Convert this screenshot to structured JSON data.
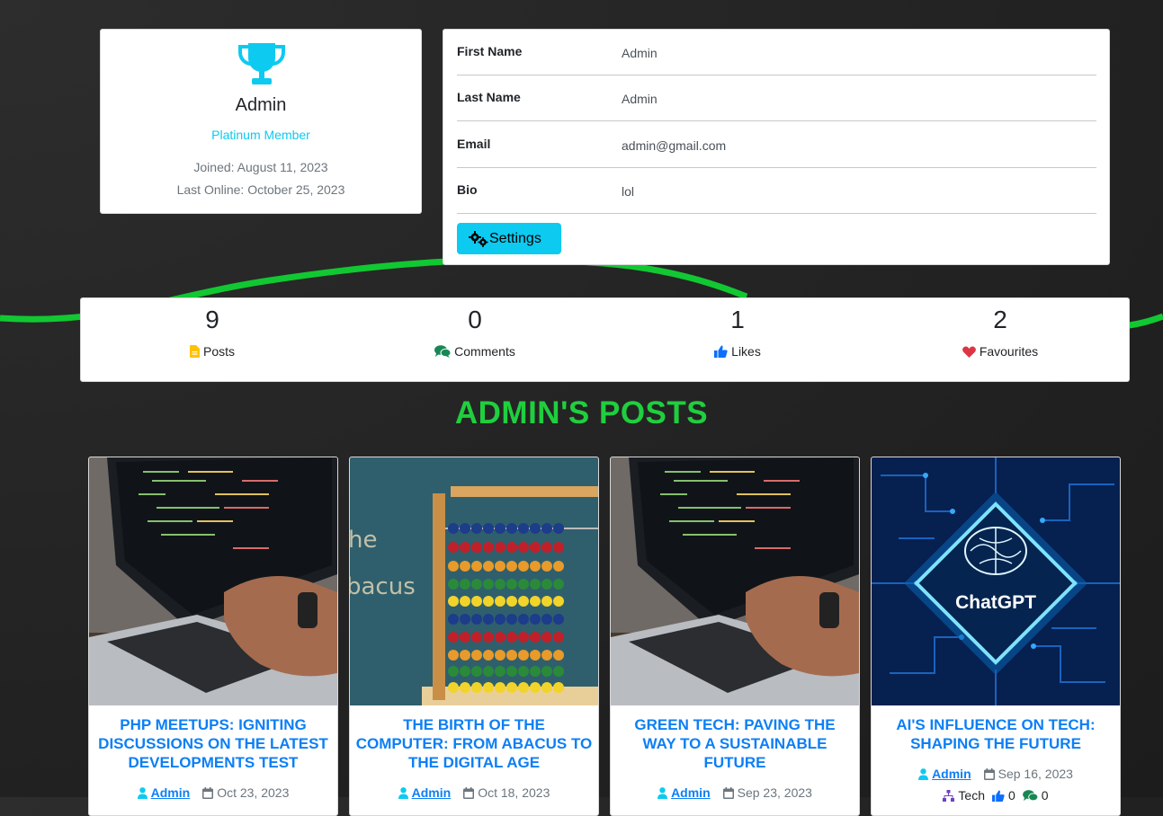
{
  "profile": {
    "name": "Admin",
    "rank": "Platinum Member",
    "joined": "Joined: August 11, 2023",
    "last_online": "Last Online: October 25, 2023"
  },
  "info": {
    "rows": [
      {
        "label": "First Name",
        "value": "Admin"
      },
      {
        "label": "Last Name",
        "value": "Admin"
      },
      {
        "label": "Email",
        "value": "admin@gmail.com"
      },
      {
        "label": "Bio",
        "value": "lol"
      }
    ],
    "settings_label": "Settings"
  },
  "stats": [
    {
      "count": "9",
      "label": "Posts",
      "icon": "file-icon",
      "color": "#ffc107"
    },
    {
      "count": "0",
      "label": "Comments",
      "icon": "comments-icon",
      "color": "#198754"
    },
    {
      "count": "1",
      "label": "Likes",
      "icon": "thumbs-up-icon",
      "color": "#0d6efd"
    },
    {
      "count": "2",
      "label": "Favourites",
      "icon": "heart-icon",
      "color": "#dc3545"
    }
  ],
  "section_title": "ADMIN'S POSTS",
  "posts": [
    {
      "title": "PHP MEETUPS: IGNITING DISCUSSIONS ON THE LATEST DEVELOPMENTS TEST",
      "author": "Admin",
      "date": "Oct 23, 2023",
      "image": "laptop-code-image"
    },
    {
      "title": "THE BIRTH OF THE COMPUTER: FROM ABACUS TO THE DIGITAL AGE",
      "author": "Admin",
      "date": "Oct 18, 2023",
      "image": "abacus-image"
    },
    {
      "title": "GREEN TECH: PAVING THE WAY TO A SUSTAINABLE FUTURE",
      "author": "Admin",
      "date": "Sep 23, 2023",
      "image": "laptop-code-image"
    },
    {
      "title": "AI'S INFLUENCE ON TECH: SHAPING THE FUTURE",
      "author": "Admin",
      "date": "Sep 16, 2023",
      "image": "chatgpt-chip-image",
      "category": "Tech",
      "likes": "0",
      "comments": "0"
    }
  ],
  "colors": {
    "accent_green": "#1fcf3e",
    "link_blue": "#0d7ff5",
    "info_cyan": "#0dcaf0"
  }
}
